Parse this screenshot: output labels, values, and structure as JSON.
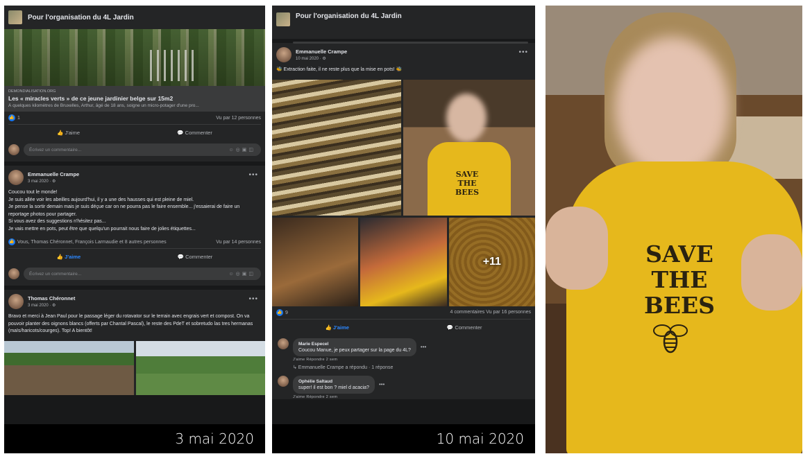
{
  "group_name": "Pour l'organisation du 4L Jardin",
  "panel1": {
    "link_post": {
      "link_domain": "DEMONDIALISATION.ORG",
      "link_title": "Les « miracles verts » de ce jeune jardinier belge sur 15m2",
      "link_desc": "À quelques kilomètres de Bruxelles, Arthur, âgé de 18 ans, soigne un micro-potager d'une pro...",
      "reaction_count": "1",
      "views": "Vu par 12 personnes",
      "like_label": "J'aime",
      "comment_label": "Commenter",
      "comment_placeholder": "Écrivez un commentaire..."
    },
    "post2": {
      "author": "Emmanuelle Crampe",
      "date": "3 mai 2020 · ⚙",
      "body": "Coucou tout le monde!\nJe suis allée voir les abeilles aujourd'hui, il y a une des hausses qui est pleine de miel.\nJe pense la sortir demain mais je suis déçue car on ne pourra pas le faire ensemble... j'essaierai de faire un reportage photos pour partager.\nSi vous avez des suggestions n'hésitez pas...\nJe vais mettre en pots, peut être que quelqu'un pourrait nous faire de jolies étiquettes...",
      "reactions": "Vous, Thomas Chéronnet, François Larmaudie et 8 autres personnes",
      "views": "Vu par 14 personnes",
      "like_label": "J'aime",
      "comment_label": "Commenter",
      "comment_placeholder": "Écrivez un commentaire..."
    },
    "post3": {
      "author": "Thomas Chéronnet",
      "date": "3 mai 2020 · ⚙",
      "body": "Bravo et merci à Jean Paul pour le passage léger du rotavator sur le terrain avec engrais vert et compost. On va pouvoir planter des oignons blancs (offerts par Chantal Pascal), le reste des PdeT et sobretudo las tres hermanas (maïs/haricots/courges). Top! A bientôt!"
    },
    "caption": "3 mai 2020"
  },
  "panel2": {
    "post": {
      "author": "Emmanuelle Crampe",
      "date": "10 mai 2020 · ⚙",
      "body": "🐝 Extraction faite, il ne reste plus que la mise en pots! 🐝",
      "shirt_text": "SAVE\nTHE\nBEES",
      "more_photos": "+11",
      "reaction_count": "9",
      "stats_right": "4 commentaires  Vu par 16 personnes",
      "like_label": "J'aime",
      "comment_label": "Commenter"
    },
    "comments": [
      {
        "name": "Marie Especel",
        "text": "Coucou Manue, je peux partager sur la page du 4L?",
        "actions": "J'aime  Répondre  2 sem"
      },
      {
        "name": "Ophélie Saltaud",
        "text": "super! il est bon ? miel d acacia?",
        "actions": "J'aime  Répondre  2 sem"
      }
    ],
    "reply_note": "↳ Emmanuelle Crampe a répondu · 1 réponse",
    "caption": "10 mai 2020"
  },
  "panel3": {
    "shirt_text": "SAVE\nTHE\nBEES"
  },
  "colors": {
    "fb_dark_bg": "#18191a",
    "fb_card": "#242526",
    "fb_blue": "#2d88ff",
    "shirt_yellow": "#e6b81c"
  }
}
